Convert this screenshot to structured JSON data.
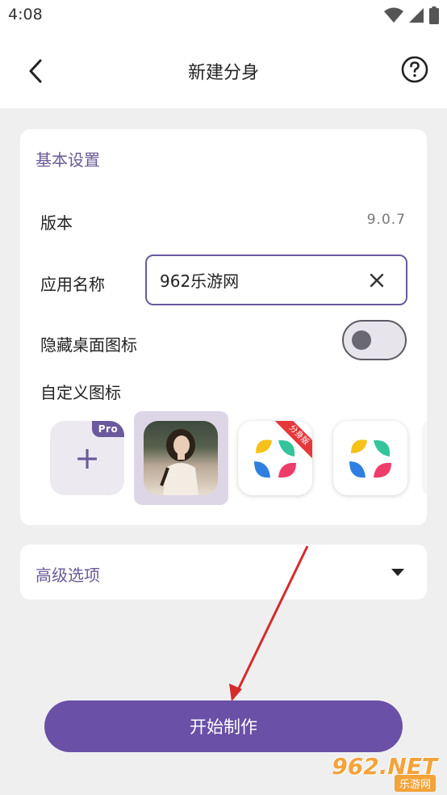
{
  "status_bar": {
    "time": "4:08"
  },
  "app_bar": {
    "title": "新建分身",
    "back_icon": "chevron-left-icon",
    "help_icon": "question-circle-icon"
  },
  "basic_settings": {
    "section_title": "基本设置",
    "version_label": "版本",
    "version_value": "9.0.7",
    "app_name_label": "应用名称",
    "app_name_value": "962乐游网",
    "hide_icon_label": "隐藏桌面图标",
    "hide_icon_enabled": false,
    "custom_icon_label": "自定义图标",
    "pro_badge": "Pro",
    "app_icon_ribbon": "分身版"
  },
  "advanced": {
    "title": "高级选项"
  },
  "actions": {
    "start_label": "开始制作"
  },
  "watermark": {
    "main": "962.NET",
    "sub": "乐游网"
  },
  "colors": {
    "accent": "#6a50a6",
    "section_title": "#6a5a96",
    "annotation_arrow": "#d62b2b"
  }
}
